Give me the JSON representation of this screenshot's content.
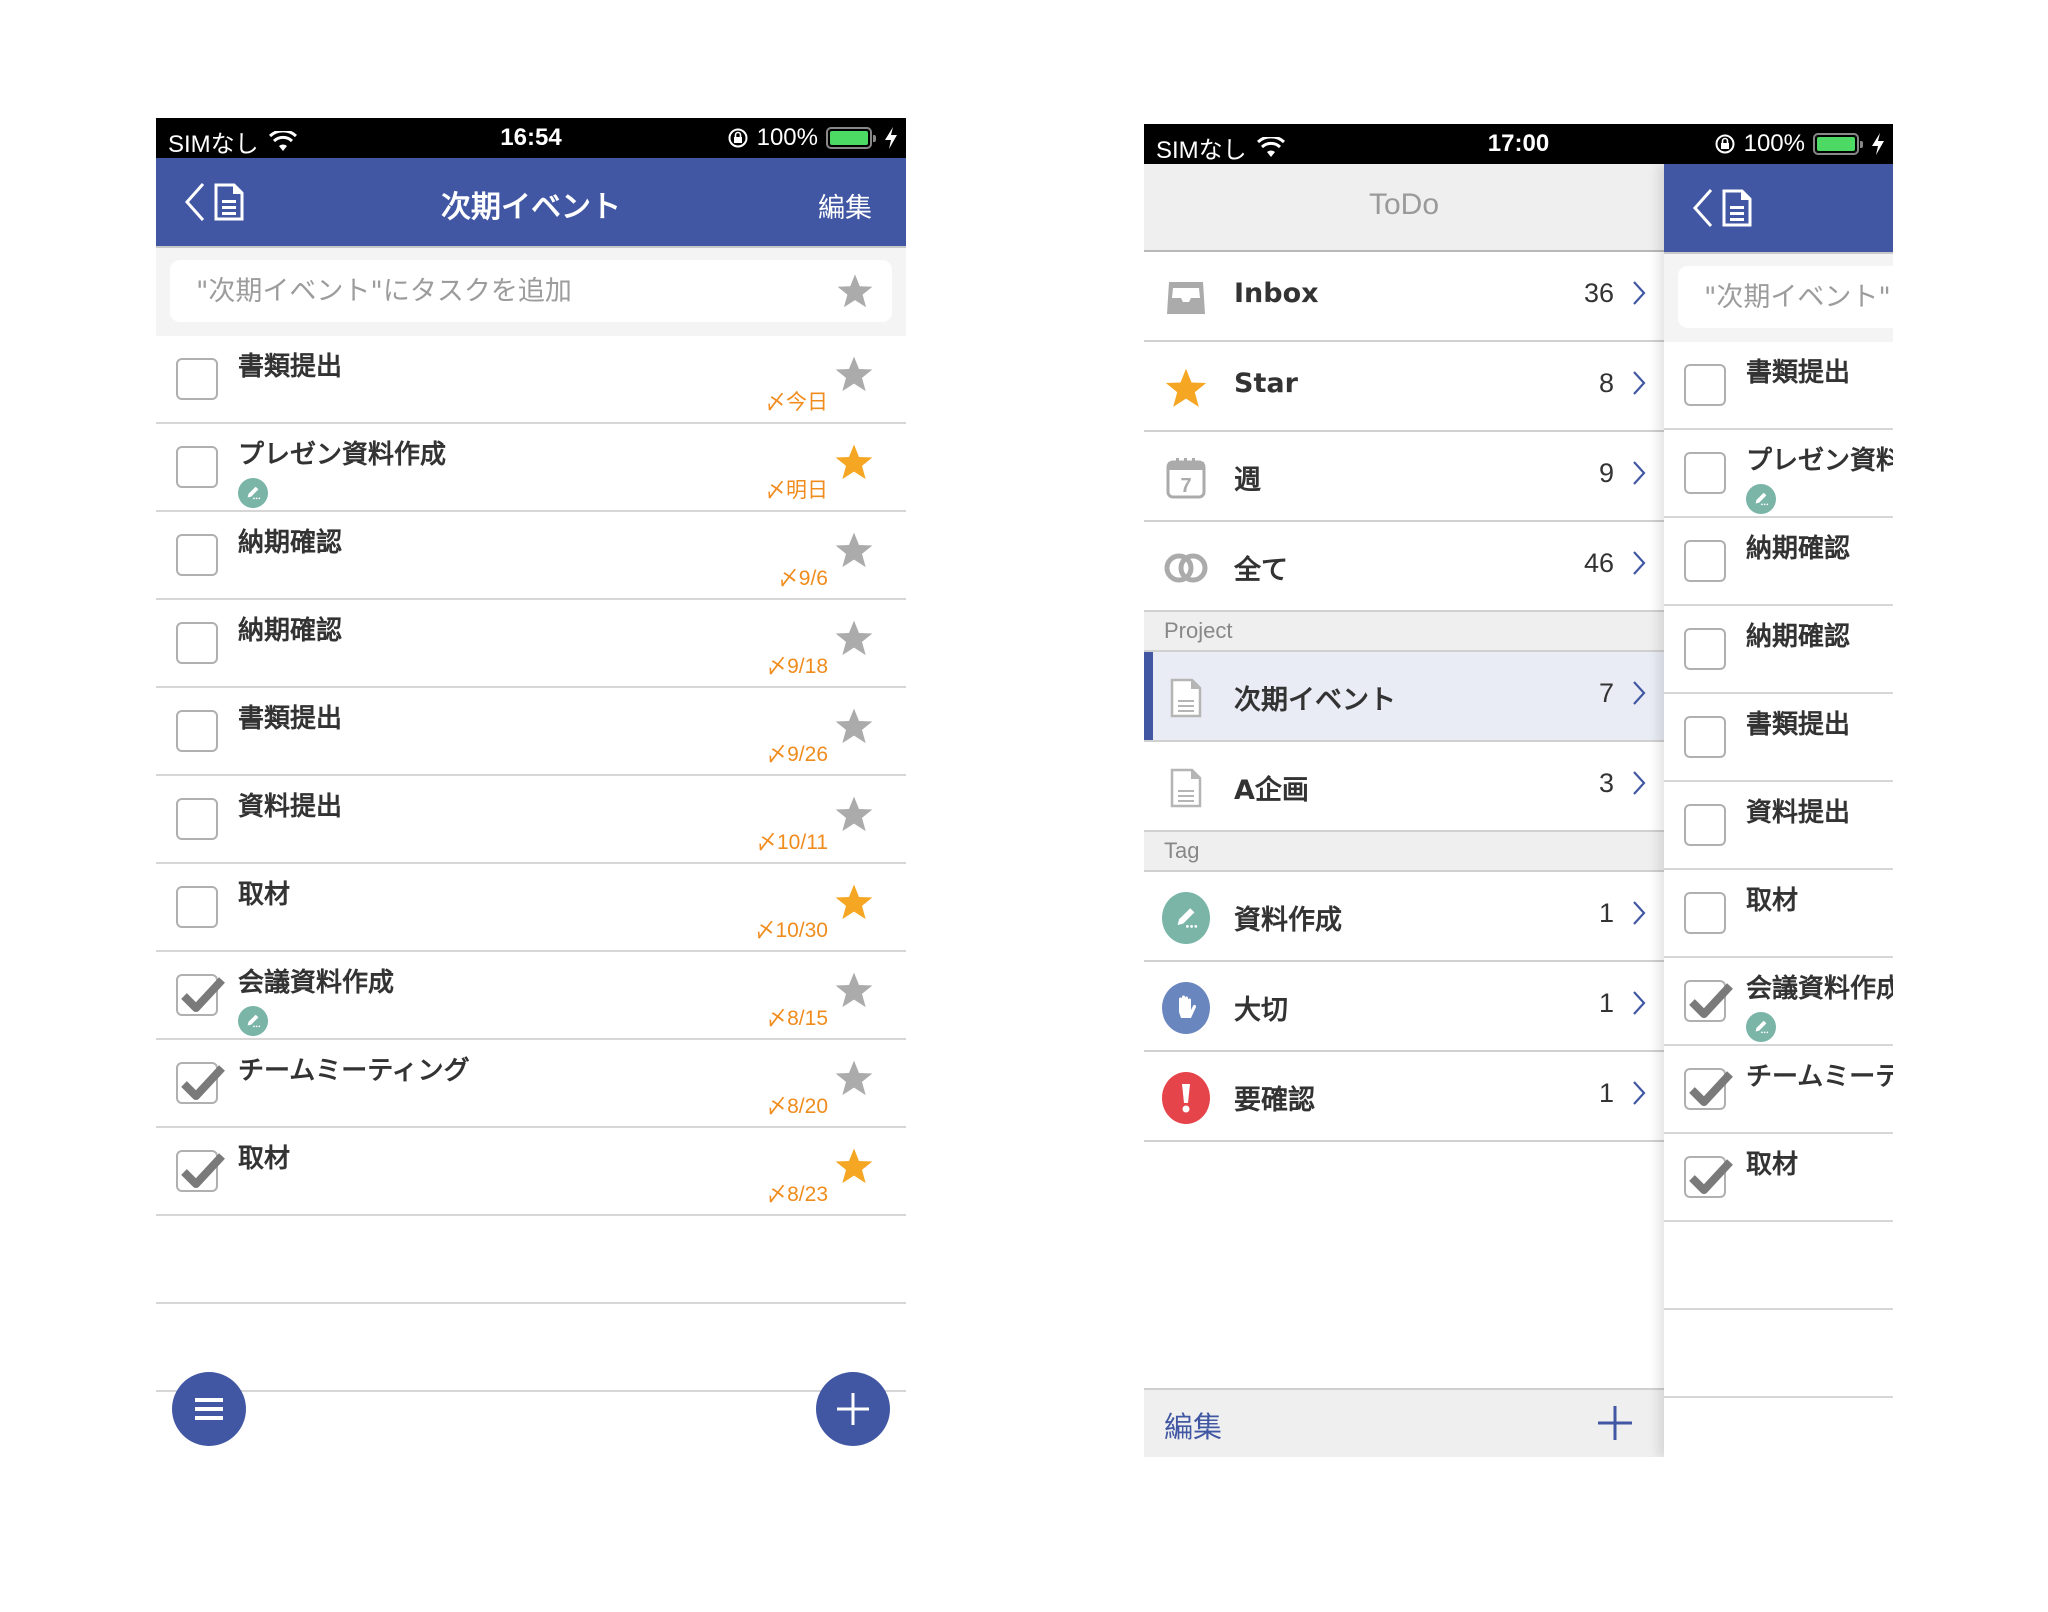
{
  "left_screen": {
    "status_bar": {
      "carrier": "SIMなし",
      "time": "16:54",
      "battery": "100%"
    },
    "header": {
      "title": "次期イベント",
      "edit_label": "編集"
    },
    "search": {
      "placeholder": "\"次期イベント\"にタスクを追加"
    },
    "tasks": [
      {
        "name": "書類提出",
        "due": "今日",
        "starred": false,
        "done": false,
        "tag": null
      },
      {
        "name": "プレゼン資料作成",
        "due": "明日",
        "starred": true,
        "done": false,
        "tag": "pencil"
      },
      {
        "name": "納期確認",
        "due": "9/6",
        "starred": false,
        "done": false,
        "tag": null
      },
      {
        "name": "納期確認",
        "due": "9/18",
        "starred": false,
        "done": false,
        "tag": null
      },
      {
        "name": "書類提出",
        "due": "9/26",
        "starred": false,
        "done": false,
        "tag": null
      },
      {
        "name": "資料提出",
        "due": "10/11",
        "starred": false,
        "done": false,
        "tag": null
      },
      {
        "name": "取材",
        "due": "10/30",
        "starred": true,
        "done": false,
        "tag": null
      },
      {
        "name": "会議資料作成",
        "due": "8/15",
        "starred": false,
        "done": true,
        "tag": "pencil"
      },
      {
        "name": "チームミーティング",
        "due": "8/20",
        "starred": false,
        "done": true,
        "tag": null
      },
      {
        "name": "取材",
        "due": "8/23",
        "starred": true,
        "done": true,
        "tag": null
      }
    ],
    "due_prefix": "〆",
    "fab_menu_icon": "menu-icon",
    "fab_add_icon": "plus-icon"
  },
  "right_screen": {
    "status_bar": {
      "carrier": "SIMなし",
      "time": "17:00",
      "battery": "100%"
    },
    "sidebar": {
      "title": "ToDo",
      "smart_lists": [
        {
          "label": "Inbox",
          "count": "36",
          "icon": "inbox-icon"
        },
        {
          "label": "Star",
          "count": "8",
          "icon": "star-icon"
        },
        {
          "label": "週",
          "count": "9",
          "icon": "calendar-icon"
        },
        {
          "label": "全て",
          "count": "46",
          "icon": "rings-icon"
        }
      ],
      "project_section": "Project",
      "projects": [
        {
          "label": "次期イベント",
          "count": "7",
          "icon": "document-icon",
          "selected": true
        },
        {
          "label": "A企画",
          "count": "3",
          "icon": "document-icon",
          "selected": false
        }
      ],
      "tag_section": "Tag",
      "tags": [
        {
          "label": "資料作成",
          "count": "1",
          "icon": "pencil-icon",
          "color": "#7ab5a8"
        },
        {
          "label": "大切",
          "count": "1",
          "icon": "hand-icon",
          "color": "#6a86bf"
        },
        {
          "label": "要確認",
          "count": "1",
          "icon": "exclamation-icon",
          "color": "#e5444a"
        }
      ],
      "footer_edit": "編集"
    },
    "peek_panel": {
      "search_placeholder": "\"次期イベント\"にタスクを追加"
    }
  },
  "colors": {
    "accent": "#4157a3",
    "star_on": "#f5a623",
    "star_off": "#ababab",
    "due": "#f08c1e"
  }
}
